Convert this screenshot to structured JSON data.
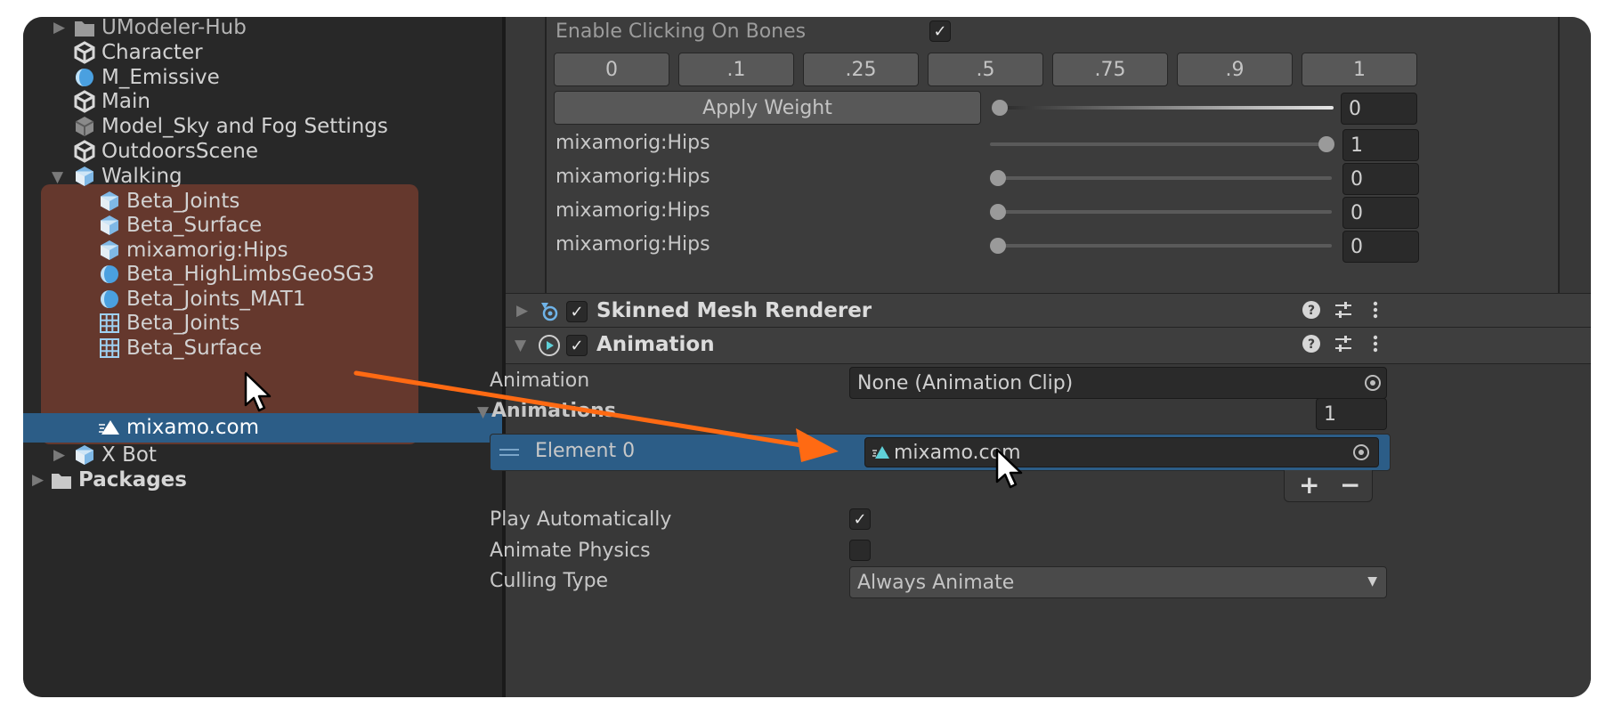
{
  "hierarchy": {
    "items": [
      {
        "label": "UModeler-Hub",
        "icon": "folder-icon"
      },
      {
        "label": "Character",
        "icon": "unity-prefab-icon"
      },
      {
        "label": "M_Emissive",
        "icon": "material-icon"
      },
      {
        "label": "Main",
        "icon": "unity-prefab-icon"
      },
      {
        "label": "Model_Sky and Fog Settings",
        "icon": "settings-asset-icon"
      },
      {
        "label": "OutdoorsScene",
        "icon": "unity-prefab-icon"
      },
      {
        "label": "Walking",
        "icon": "model-prefab-icon"
      },
      {
        "label": "Beta_Joints",
        "icon": "model-prefab-icon"
      },
      {
        "label": "Beta_Surface",
        "icon": "model-prefab-icon"
      },
      {
        "label": "mixamorig:Hips",
        "icon": "model-prefab-icon"
      },
      {
        "label": "Beta_HighLimbsGeoSG3",
        "icon": "material-icon"
      },
      {
        "label": "Beta_Joints_MAT1",
        "icon": "material-icon"
      },
      {
        "label": "Beta_Joints",
        "icon": "mesh-grid-icon"
      },
      {
        "label": "Beta_Surface",
        "icon": "mesh-grid-icon"
      },
      {
        "label": "mixamo.com",
        "icon": "animation-clip-icon"
      },
      {
        "label": "X Bot",
        "icon": "model-prefab-icon"
      },
      {
        "label": "Packages",
        "icon": "folder-icon"
      }
    ]
  },
  "bones": {
    "enable_clicking_label": "Enable Clicking On Bones",
    "enable_clicking_checked": true,
    "weight_presets": [
      "0",
      ".1",
      ".25",
      ".5",
      ".75",
      ".9",
      "1"
    ],
    "apply_weight_label": "Apply Weight",
    "apply_weight_value": "0",
    "apply_weight_slider": 0,
    "rows": [
      {
        "name": "mixamorig:Hips",
        "value": "1",
        "slider": 1
      },
      {
        "name": "mixamorig:Hips",
        "value": "0",
        "slider": 0
      },
      {
        "name": "mixamorig:Hips",
        "value": "0",
        "slider": 0
      },
      {
        "name": "mixamorig:Hips",
        "value": "0",
        "slider": 0
      }
    ]
  },
  "components": {
    "skinned_mesh_renderer": {
      "title": "Skinned Mesh Renderer",
      "enabled": true,
      "expanded": false
    },
    "animation": {
      "title": "Animation",
      "enabled": true,
      "expanded": true
    }
  },
  "animation": {
    "animation_label": "Animation",
    "animation_value": "None (Animation Clip)",
    "animations_label": "Animations",
    "animations_count": "1",
    "element_label": "Element 0",
    "element_value": "mixamo.com",
    "add_label": "+",
    "remove_label": "−",
    "play_auto_label": "Play Automatically",
    "play_auto_checked": true,
    "animate_physics_label": "Animate Physics",
    "animate_physics_checked": false,
    "culling_label": "Culling Type",
    "culling_value": "Always Animate"
  },
  "colors": {
    "drag_arrow": "#ff6a13",
    "selection": "#2c5d87",
    "highlight_box": "#6b3a2e"
  }
}
